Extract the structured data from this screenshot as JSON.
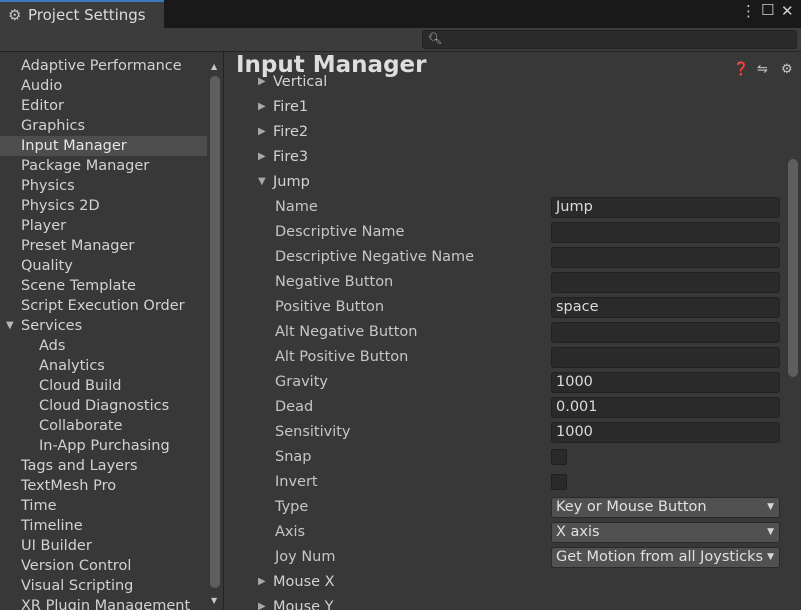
{
  "window": {
    "tab_title": "Project Settings",
    "menu_icon": "kebab-menu-icon",
    "maximize_icon": "maximize-icon",
    "close_icon": "close-icon"
  },
  "search": {
    "placeholder": "",
    "value": ""
  },
  "sidebar": {
    "selected": "Input Manager",
    "items": [
      {
        "label": "Adaptive Performance",
        "level": 0
      },
      {
        "label": "Audio",
        "level": 0
      },
      {
        "label": "Editor",
        "level": 0
      },
      {
        "label": "Graphics",
        "level": 0
      },
      {
        "label": "Input Manager",
        "level": 0
      },
      {
        "label": "Package Manager",
        "level": 0
      },
      {
        "label": "Physics",
        "level": 0
      },
      {
        "label": "Physics 2D",
        "level": 0
      },
      {
        "label": "Player",
        "level": 0
      },
      {
        "label": "Preset Manager",
        "level": 0
      },
      {
        "label": "Quality",
        "level": 0
      },
      {
        "label": "Scene Template",
        "level": 0
      },
      {
        "label": "Script Execution Order",
        "level": 0
      },
      {
        "label": "Services",
        "level": 0,
        "expanded": true
      },
      {
        "label": "Ads",
        "level": 1
      },
      {
        "label": "Analytics",
        "level": 1
      },
      {
        "label": "Cloud Build",
        "level": 1
      },
      {
        "label": "Cloud Diagnostics",
        "level": 1
      },
      {
        "label": "Collaborate",
        "level": 1
      },
      {
        "label": "In-App Purchasing",
        "level": 1
      },
      {
        "label": "Tags and Layers",
        "level": 0
      },
      {
        "label": "TextMesh Pro",
        "level": 0
      },
      {
        "label": "Time",
        "level": 0
      },
      {
        "label": "Timeline",
        "level": 0
      },
      {
        "label": "UI Builder",
        "level": 0
      },
      {
        "label": "Version Control",
        "level": 0
      },
      {
        "label": "Visual Scripting",
        "level": 0
      },
      {
        "label": "XR Plugin Management",
        "level": 0
      }
    ]
  },
  "main": {
    "title": "Input Manager",
    "header_icons": [
      "help-icon",
      "preset-sliders-icon",
      "settings-gear-icon"
    ],
    "axes_before": [
      {
        "label": "Vertical",
        "expanded": false
      },
      {
        "label": "Fire1",
        "expanded": false
      },
      {
        "label": "Fire2",
        "expanded": false
      },
      {
        "label": "Fire3",
        "expanded": false
      }
    ],
    "expanded_axis": {
      "label": "Jump",
      "properties": [
        {
          "label": "Name",
          "kind": "text",
          "value": "Jump"
        },
        {
          "label": "Descriptive Name",
          "kind": "text",
          "value": ""
        },
        {
          "label": "Descriptive Negative Name",
          "kind": "text",
          "value": ""
        },
        {
          "label": "Negative Button",
          "kind": "text",
          "value": ""
        },
        {
          "label": "Positive Button",
          "kind": "text",
          "value": "space"
        },
        {
          "label": "Alt Negative Button",
          "kind": "text",
          "value": ""
        },
        {
          "label": "Alt Positive Button",
          "kind": "text",
          "value": ""
        },
        {
          "label": "Gravity",
          "kind": "text",
          "value": "1000"
        },
        {
          "label": "Dead",
          "kind": "text",
          "value": "0.001"
        },
        {
          "label": "Sensitivity",
          "kind": "text",
          "value": "1000"
        },
        {
          "label": "Snap",
          "kind": "checkbox",
          "value": false
        },
        {
          "label": "Invert",
          "kind": "checkbox",
          "value": false
        },
        {
          "label": "Type",
          "kind": "select",
          "value": "Key or Mouse Button"
        },
        {
          "label": "Axis",
          "kind": "select",
          "value": "X axis"
        },
        {
          "label": "Joy Num",
          "kind": "select",
          "value": "Get Motion from all Joysticks"
        }
      ]
    },
    "axes_after": [
      {
        "label": "Mouse X",
        "expanded": false
      },
      {
        "label": "Mouse Y",
        "expanded": false
      }
    ]
  }
}
